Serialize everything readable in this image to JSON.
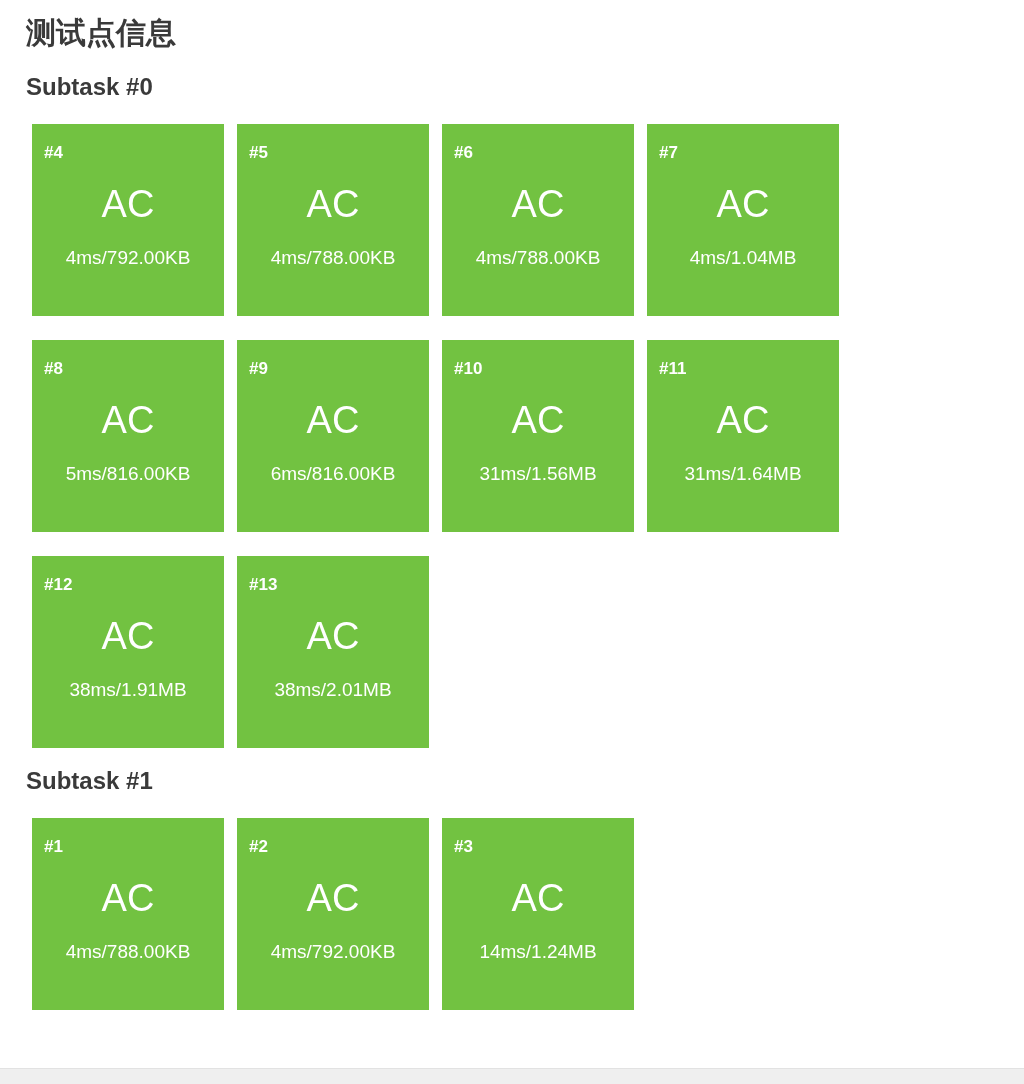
{
  "title": "测试点信息",
  "subtasks": [
    {
      "title": "Subtask #0",
      "cases": [
        {
          "id": "#4",
          "kind": "accepted",
          "verdict": "AC",
          "usage": "4ms/792.00KB"
        },
        {
          "id": "#5",
          "kind": "accepted",
          "verdict": "AC",
          "usage": "4ms/788.00KB"
        },
        {
          "id": "#6",
          "kind": "accepted",
          "verdict": "AC",
          "usage": "4ms/788.00KB"
        },
        {
          "id": "#7",
          "kind": "accepted",
          "verdict": "AC",
          "usage": "4ms/1.04MB"
        },
        {
          "id": "#8",
          "kind": "accepted",
          "verdict": "AC",
          "usage": "5ms/816.00KB"
        },
        {
          "id": "#9",
          "kind": "accepted",
          "verdict": "AC",
          "usage": "6ms/816.00KB"
        },
        {
          "id": "#10",
          "kind": "accepted",
          "verdict": "AC",
          "usage": "31ms/1.56MB"
        },
        {
          "id": "#11",
          "kind": "accepted",
          "verdict": "AC",
          "usage": "31ms/1.64MB"
        },
        {
          "id": "#12",
          "kind": "accepted",
          "verdict": "AC",
          "usage": "38ms/1.91MB"
        },
        {
          "id": "#13",
          "kind": "accepted",
          "verdict": "AC",
          "usage": "38ms/2.01MB"
        }
      ]
    },
    {
      "title": "Subtask #1",
      "cases": [
        {
          "id": "#1",
          "kind": "accepted",
          "verdict": "AC",
          "usage": "4ms/788.00KB"
        },
        {
          "id": "#2",
          "kind": "accepted",
          "verdict": "AC",
          "usage": "4ms/792.00KB"
        },
        {
          "id": "#3",
          "kind": "accepted",
          "verdict": "AC",
          "usage": "14ms/1.24MB"
        }
      ]
    }
  ]
}
